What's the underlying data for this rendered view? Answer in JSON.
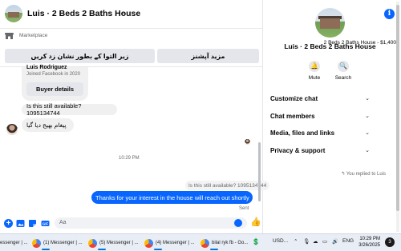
{
  "chat": {
    "title": "Luis · 2 Beds 2 Baths House",
    "marketplace_label": "Marketplace",
    "listing": "2 Beds 2 Baths House - $1,400",
    "btn_right": "مزید آپشنز",
    "btn_left": "زیر التوا کے بطور نشان زد کریں",
    "card": {
      "name": "Luis Rodriguez",
      "joined": "Joined Facebook in 2020",
      "button": "Buyer details"
    },
    "messages": {
      "in1": "Is this still available? 1095134744",
      "in2": "پیغام بھیج دیا گیا",
      "time": "10:29 PM",
      "replied": "You replied to Luis",
      "quoted": "Is this still available? 1095134744",
      "out1": "Thanks for your interest in the house will reach out shortly",
      "status": "Sent"
    },
    "composer_placeholder": "Aa"
  },
  "side": {
    "title": "Luis · 2 Beds 2 Baths House",
    "actions": [
      {
        "label": "Mute",
        "icon": "bell-icon"
      },
      {
        "label": "Search",
        "icon": "search-icon"
      }
    ],
    "rows": [
      {
        "label": "Customize chat"
      },
      {
        "label": "Chat members"
      },
      {
        "label": "Media, files and links"
      },
      {
        "label": "Privacy & support"
      }
    ]
  },
  "taskbar": {
    "items": [
      {
        "label": "essenger | ..."
      },
      {
        "label": "(1) Messenger | ..."
      },
      {
        "label": "(5) Messenger | ..."
      },
      {
        "label": "(4) Messenger | ..."
      },
      {
        "label": "bilal ryk fb - Go..."
      }
    ],
    "currency": "USD...",
    "lang": "ENG",
    "time": "10:29 PM",
    "date": "3/26/2025",
    "notifications": "3"
  },
  "colors": {
    "accent": "#0866ff",
    "bubble_in": "#f0f0f0",
    "button_bg": "#e4e6eb"
  }
}
